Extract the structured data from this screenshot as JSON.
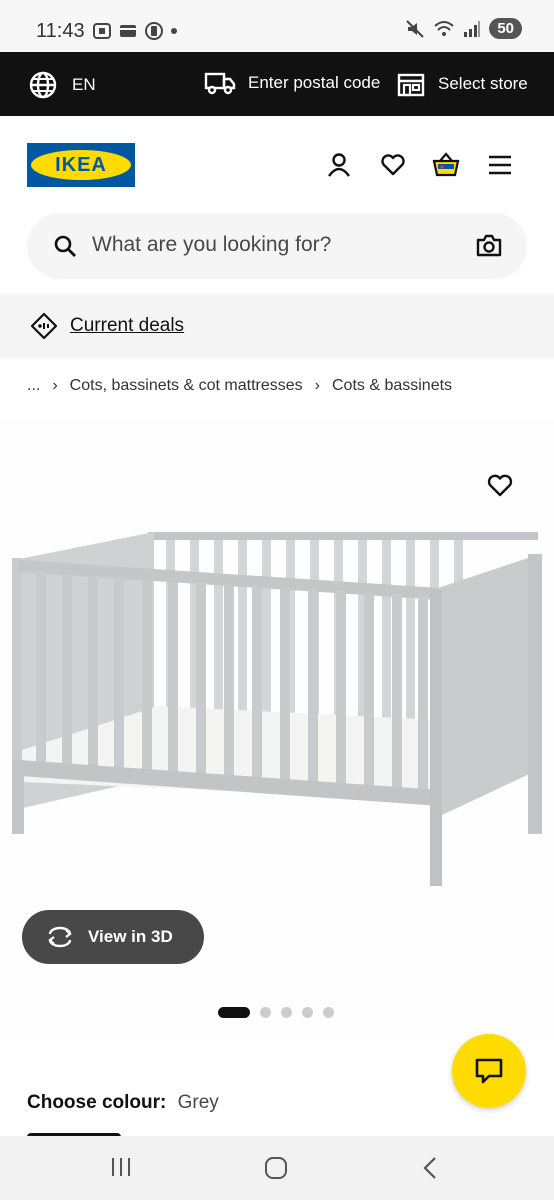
{
  "status_bar": {
    "time": "11:43",
    "battery": "50"
  },
  "top_bar": {
    "language": "EN",
    "postal_label": "Enter postal code",
    "store_label": "Select store"
  },
  "header": {
    "logo_text": "IKEA",
    "search_placeholder": "What are you looking for?"
  },
  "deals": {
    "label": "Current deals"
  },
  "breadcrumb": {
    "ellipsis": "...",
    "items": [
      "Cots, bassinets & cot mattresses",
      "Cots & bassinets"
    ]
  },
  "product": {
    "view3d_label": "View in 3D",
    "image_count": 5,
    "active_image": 1
  },
  "colour": {
    "label": "Choose colour:",
    "value": "Grey"
  },
  "colors": {
    "brand_blue": "#0058a3",
    "brand_yellow": "#ffdb00",
    "dark": "#111111"
  }
}
